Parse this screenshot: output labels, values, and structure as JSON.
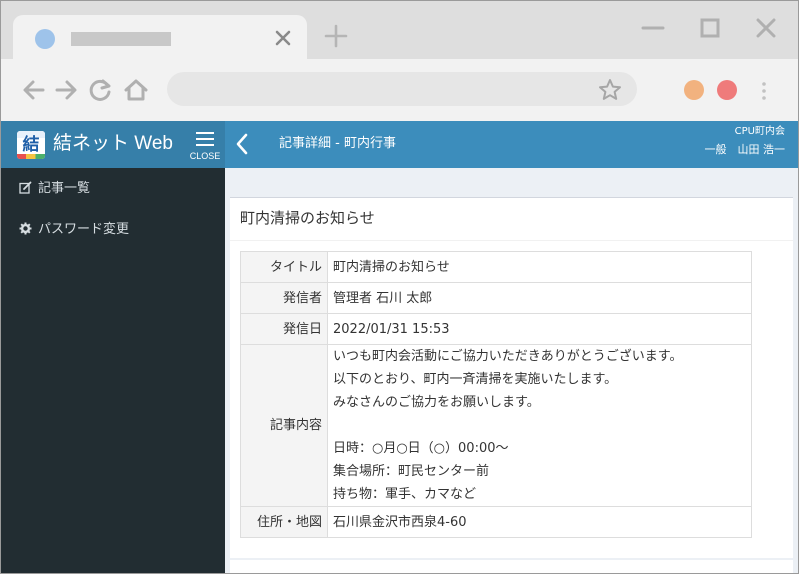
{
  "app": {
    "brand": "結ネット Web",
    "logo_char": "結",
    "menu_close_label": "CLOSE",
    "page_title": "記事詳細 - 町内行事",
    "org_name": "CPU町内会",
    "user_label": "一般　山田 浩一"
  },
  "sidebar": {
    "items": [
      {
        "label": "記事一覧",
        "icon": "edit-icon"
      },
      {
        "label": "パスワード変更",
        "icon": "gear-icon"
      }
    ]
  },
  "article": {
    "heading": "町内清掃のお知らせ",
    "rows": [
      {
        "label": "タイトル",
        "value": "町内清掃のお知らせ"
      },
      {
        "label": "発信者",
        "value": "管理者 石川 太郎"
      },
      {
        "label": "発信日",
        "value": "2022/01/31 15:53"
      },
      {
        "label": "記事内容",
        "value": "いつも町内会活動にご協力いただきありがとうございます。\n以下のとおり、町内一斉清掃を実施いたします。\nみなさんのご協力をお願いします。\n\n日時：○月○日（○）00:00～\n集合場所：町民センター前\n持ち物：軍手、カマなど"
      },
      {
        "label": "住所・地図",
        "value": "石川県金沢市西泉4-60"
      }
    ]
  },
  "colors": {
    "header": "#3c8dbc",
    "header_brand": "#367fa9",
    "sidebar": "#222d32",
    "content_bg": "#ecf0f5"
  }
}
